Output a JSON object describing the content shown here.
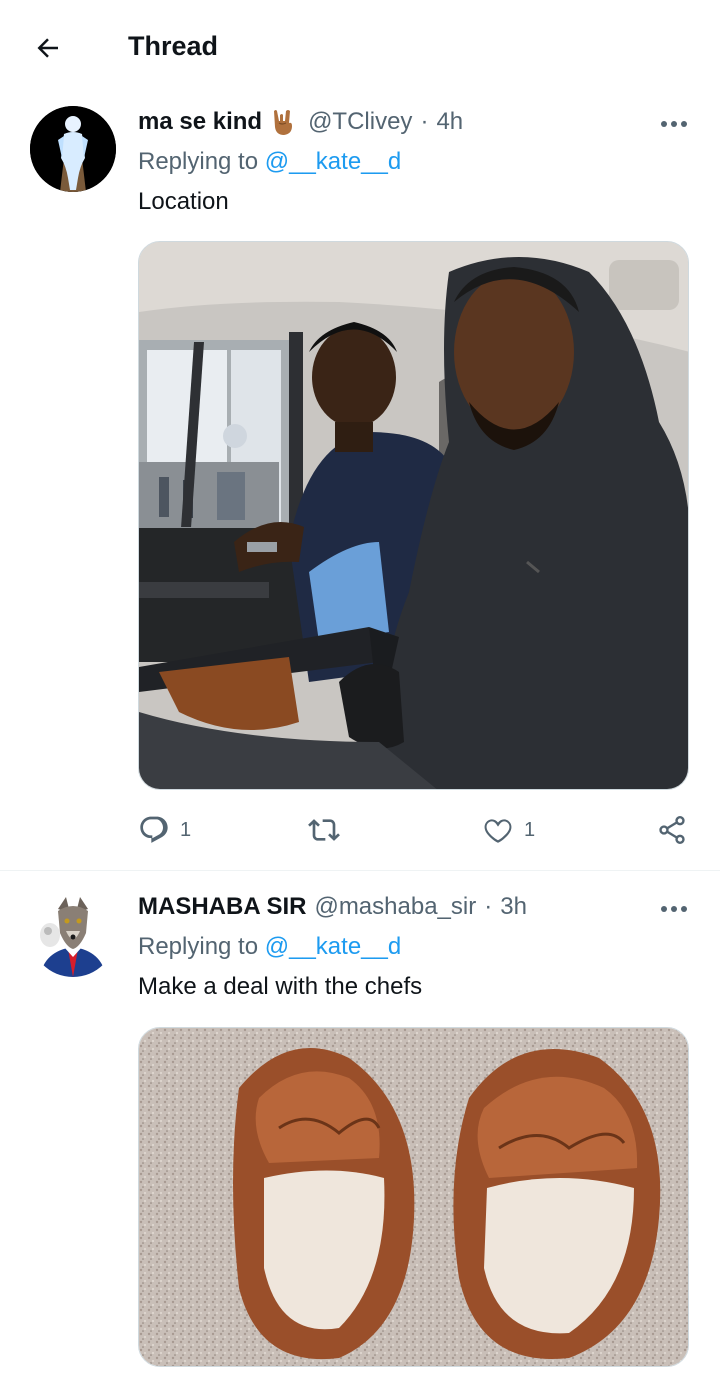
{
  "header": {
    "title": "Thread"
  },
  "tweets": [
    {
      "display_name": "ma se kind",
      "name_emoji": "🤘🏾",
      "handle": "@TClivey",
      "separator": "·",
      "time": "4h",
      "replying_prefix": "Replying to",
      "replying_handle": "@__kate__d",
      "text": "Location",
      "replies": "1",
      "retweets": "",
      "likes": "1"
    },
    {
      "display_name": "MASHABA SIR",
      "handle": "@mashaba_sir",
      "separator": "·",
      "time": "3h",
      "replying_prefix": "Replying to",
      "replying_handle": "@__kate__d",
      "text": "Make a deal with the chefs"
    }
  ],
  "colors": {
    "accent": "#1d9bf0",
    "secondary_text": "#536471",
    "primary_text": "#0f1419",
    "border": "#cfd9de"
  },
  "icons": [
    "back-arrow-icon",
    "more-icon",
    "reply-icon",
    "retweet-icon",
    "like-icon",
    "share-icon"
  ]
}
